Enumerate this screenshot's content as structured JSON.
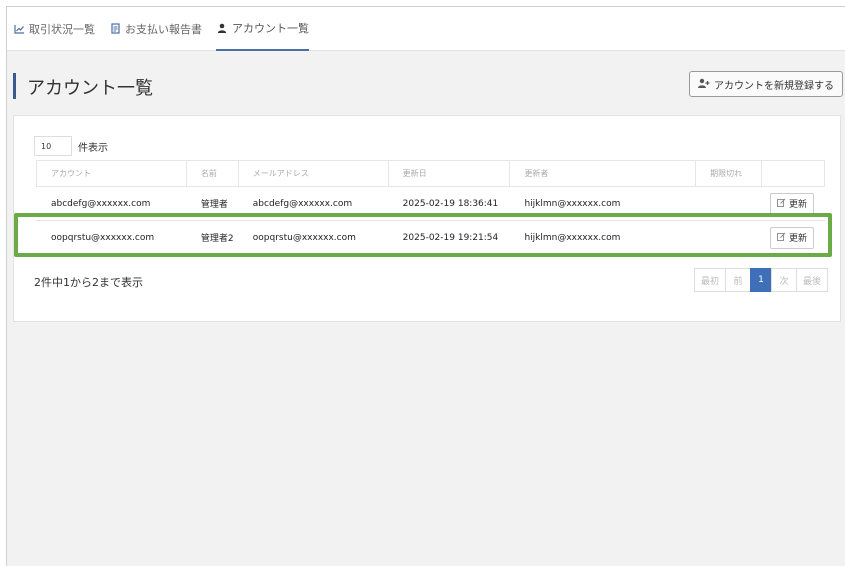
{
  "nav": {
    "items": [
      {
        "label": "取引状況一覧",
        "icon": "line-chart-icon",
        "active": false
      },
      {
        "label": "お支払い報告書",
        "icon": "document-icon",
        "active": false
      },
      {
        "label": "アカウント一覧",
        "icon": "user-icon",
        "active": true
      }
    ]
  },
  "header": {
    "title": "アカウント一覧",
    "add_button_label": "アカウントを新規登録する",
    "add_button_icon": "user-plus-icon"
  },
  "list": {
    "per_page_value": "10",
    "per_page_label": "件表示",
    "columns": [
      "アカウント",
      "名前",
      "メールアドレス",
      "更新日",
      "更新者",
      "期限切れ",
      ""
    ],
    "rows": [
      {
        "account": "abcdefg@xxxxxx.com",
        "name": "管理者",
        "email": "abcdefg@xxxxxx.com",
        "updated_at": "2025-02-19 18:36:41",
        "updated_by": "hijklmn@xxxxxx.com",
        "expired": "",
        "action": "更新"
      },
      {
        "account": "oopqrstu@xxxxxx.com",
        "name": "管理者2",
        "email": "oopqrstu@xxxxxx.com",
        "updated_at": "2025-02-19 19:21:54",
        "updated_by": "hijklmn@xxxxxx.com",
        "expired": "",
        "action": "更新"
      }
    ],
    "summary": "2件中1から2まで表示",
    "pager": {
      "first": "最初",
      "prev": "前",
      "current": "1",
      "next": "次",
      "last": "最後"
    }
  },
  "colors": {
    "accent": "#3f6fb6",
    "highlight": "#6aaa47"
  }
}
